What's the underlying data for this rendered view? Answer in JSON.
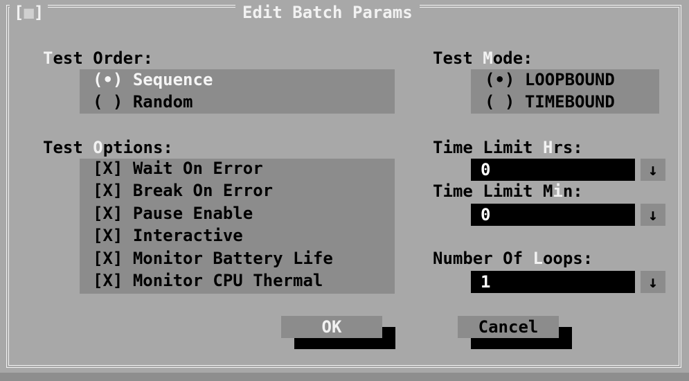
{
  "dialog": {
    "title": "Edit Batch Params",
    "close_open": "[",
    "close_mark": "■",
    "close_close": "]"
  },
  "test_order": {
    "label_hot": "T",
    "label_rest": "est Order:",
    "options": [
      {
        "mark": "(•)",
        "label": "Sequence",
        "selected": true
      },
      {
        "mark": "( )",
        "label": "Random",
        "selected": false
      }
    ]
  },
  "test_mode": {
    "label_pre": "Test ",
    "label_hot": "M",
    "label_rest": "ode:",
    "options": [
      {
        "mark": "(•)",
        "label": "LOOPBOUND",
        "selected": true
      },
      {
        "mark": "( )",
        "label": "TIMEBOUND",
        "selected": false
      }
    ]
  },
  "test_options": {
    "label_pre": "Test ",
    "label_hot": "O",
    "label_rest": "ptions:",
    "items": [
      {
        "mark": "[X]",
        "label": "Wait On Error"
      },
      {
        "mark": "[X]",
        "label": "Break On Error"
      },
      {
        "mark": "[X]",
        "label": "Pause Enable"
      },
      {
        "mark": "[X]",
        "label": "Interactive"
      },
      {
        "mark": "[X]",
        "label": "Monitor Battery Life"
      },
      {
        "mark": "[X]",
        "label": "Monitor CPU Thermal"
      }
    ]
  },
  "time_limit_hrs": {
    "label_pre": "Time Limit ",
    "label_hot": "H",
    "label_rest": "rs:",
    "value": "0",
    "arrow": "↓"
  },
  "time_limit_min": {
    "label_pre": "Time Limit M",
    "label_hot": "i",
    "label_rest": "n:",
    "value": "0",
    "arrow": "↓"
  },
  "num_loops": {
    "label_pre": "Number Of ",
    "label_hot": "L",
    "label_rest": "oops:",
    "value": "1",
    "arrow": "↓"
  },
  "buttons": {
    "ok": "OK",
    "cancel": "Cancel"
  }
}
